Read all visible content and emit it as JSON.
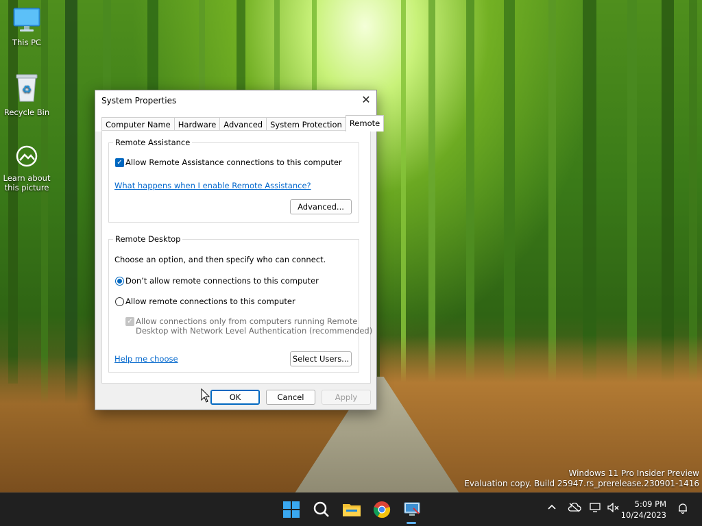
{
  "desktop": {
    "icons": [
      {
        "label": "This PC",
        "icon": "monitor-icon"
      },
      {
        "label": "Recycle Bin",
        "icon": "recycle-bin-icon"
      },
      {
        "label": "Learn about\nthis picture",
        "icon": "camera-info-icon"
      }
    ],
    "watermark": {
      "line1": "Windows 11 Pro Insider Preview",
      "line2": "Evaluation copy. Build 25947.rs_prerelease.230901-1416"
    }
  },
  "dialog": {
    "title": "System Properties",
    "tabs": [
      {
        "label": "Computer Name"
      },
      {
        "label": "Hardware"
      },
      {
        "label": "Advanced"
      },
      {
        "label": "System Protection"
      },
      {
        "label": "Remote",
        "active": true
      }
    ],
    "remote_assistance": {
      "legend": "Remote Assistance",
      "allow_checkbox_label": "Allow Remote Assistance connections to this computer",
      "allow_checked": true,
      "help_link": "What happens when I enable Remote Assistance?",
      "advanced_button": "Advanced..."
    },
    "remote_desktop": {
      "legend": "Remote Desktop",
      "instruction": "Choose an option, and then specify who can connect.",
      "option_dont_allow": "Don’t allow remote connections to this computer",
      "option_allow": "Allow remote connections to this computer",
      "selected_option": "dont_allow",
      "nla_line1": "Allow connections only from computers running Remote",
      "nla_line2": "Desktop with Network Level Authentication (recommended)",
      "nla_checked": true,
      "help_link": "Help me choose",
      "select_users_button": "Select Users..."
    },
    "buttons": {
      "ok": "OK",
      "cancel": "Cancel",
      "apply": "Apply"
    }
  },
  "taskbar": {
    "icons": [
      "windows-start-icon",
      "search-icon",
      "file-explorer-icon",
      "chrome-icon",
      "system-properties-icon"
    ],
    "tray_icons": [
      "chevron-up-icon",
      "onedrive-offline-icon",
      "network-icon",
      "volume-muted-icon",
      "notification-bell-icon"
    ],
    "time": "5:09 PM",
    "date": "10/24/2023"
  },
  "colors": {
    "accent": "#0067c0",
    "link": "#0066cc",
    "taskbar": "#202020"
  }
}
